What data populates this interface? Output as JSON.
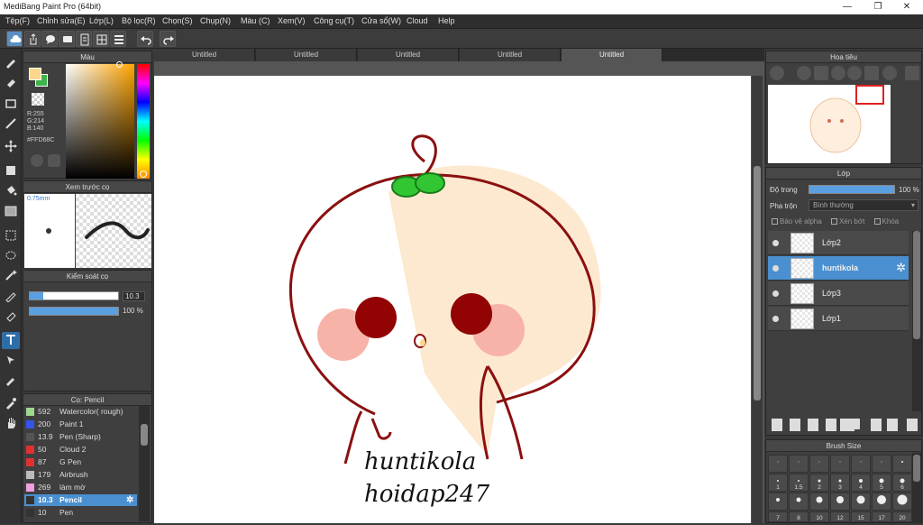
{
  "window": {
    "title": "MediBang Paint Pro (64bit)",
    "min": "—",
    "max": "❐",
    "close": "✕"
  },
  "menu": [
    "Tệp(F)",
    "Chỉnh sửa(E)",
    "Lớp(L)",
    "Bộ lọc(R)",
    "Chọn(S)",
    "Chụp(N)",
    "Màu (C)",
    "Xem(V)",
    "Công cụ(T)",
    "Cửa sổ(W)",
    "Cloud",
    "Help"
  ],
  "tabs": [
    "Untitled",
    "Untitled",
    "Untitled",
    "Untitled",
    "Untitled"
  ],
  "color_panel": {
    "title": "Màu",
    "r": "R:255",
    "g": "G:214",
    "b": "B:140",
    "hex": "#FFD68C",
    "fg_color": "#ffd68c",
    "bg_color": "#3cb44a"
  },
  "preview_panel": {
    "title": "Xem trước cọ",
    "size": "0.75mm"
  },
  "brush_control": {
    "title": "Kiểm soát cọ",
    "size_value": "10.3",
    "opacity_value": "100 %",
    "size_level": 0.15,
    "opacity_level": 1.0
  },
  "brush_panel": {
    "title": "Cọ: Pencil",
    "items": [
      {
        "size": "592",
        "name": "Watercolor( rough)",
        "color": "#9fd98e"
      },
      {
        "size": "200",
        "name": "Paint 1",
        "color": "#3355ee"
      },
      {
        "size": "13.9",
        "name": "Pen (Sharp)",
        "color": "#555555"
      },
      {
        "size": "50",
        "name": "Cloud 2",
        "color": "#e03030"
      },
      {
        "size": "87",
        "name": "G Pen",
        "color": "#e03030"
      },
      {
        "size": "179",
        "name": "Airbrush",
        "color": "#bbbbbb"
      },
      {
        "size": "269",
        "name": "làm mờ",
        "color": "#f0a0e0"
      },
      {
        "size": "10.3",
        "name": "Pencil",
        "color": "#333333"
      },
      {
        "size": "10",
        "name": "Pen",
        "color": "#333333"
      }
    ],
    "selected_index": 7
  },
  "navigator": {
    "title": "Hoa tiêu"
  },
  "layer_panel": {
    "title": "Lớp",
    "opacity_label": "Độ trong",
    "opacity_value": "100 %",
    "opacity_level": 1.0,
    "blend_label": "Pha trộn",
    "blend_value": "Bình thường",
    "protect_alpha": "Bảo vệ alpha",
    "clipping": "Xén bớt",
    "lock": "Khóa",
    "layers": [
      {
        "name": "Lớp2"
      },
      {
        "name": "huntikola"
      },
      {
        "name": "Lớp3"
      },
      {
        "name": "Lớp1"
      }
    ],
    "selected_index": 1
  },
  "brush_size_panel": {
    "title": "Brush Size",
    "row2_labels": [
      "1",
      "1.5",
      "2",
      "3",
      "4",
      "5",
      "6"
    ],
    "row4_labels": [
      "7",
      "8",
      "10",
      "12",
      "15",
      "17",
      "20"
    ]
  },
  "canvas": {
    "text_line1": "huntikola",
    "text_line2": "hoidap247"
  }
}
